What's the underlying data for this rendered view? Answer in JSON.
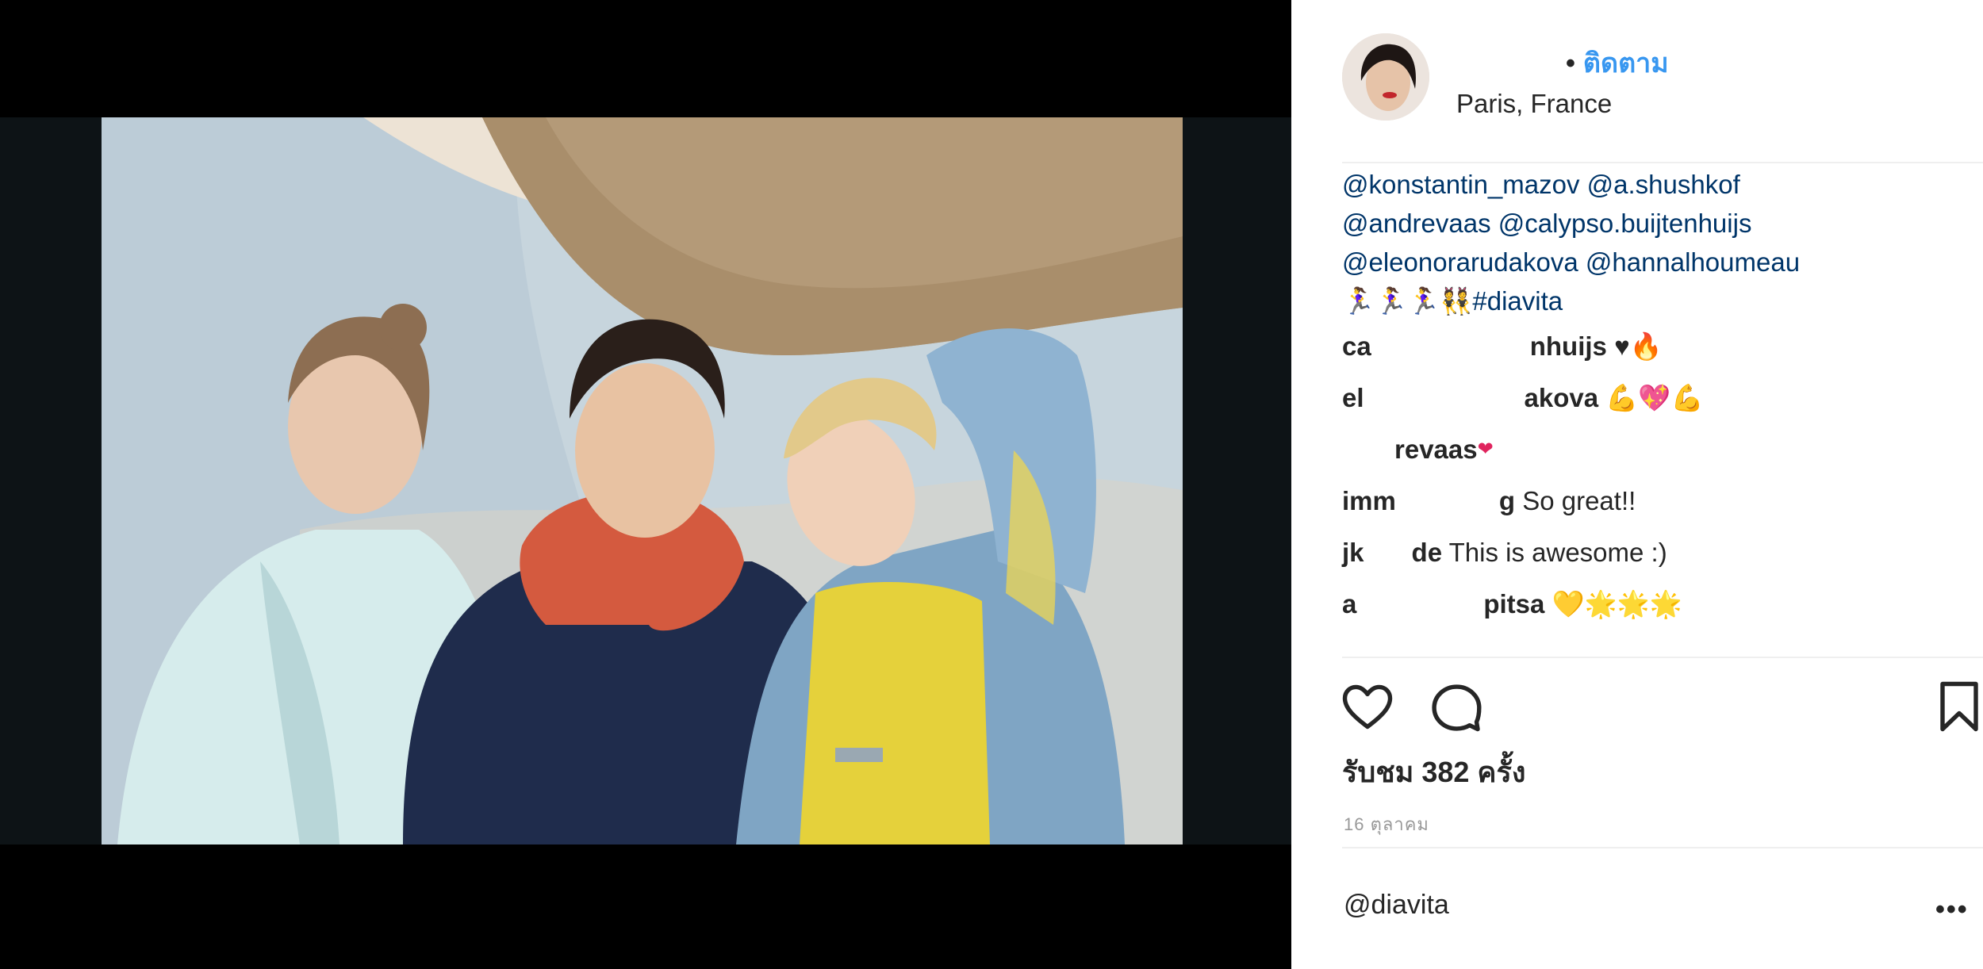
{
  "post": {
    "header": {
      "follow_label": "ติดตาม",
      "location": "Paris, France"
    },
    "caption": {
      "mentions_line1": "@konstantin_mazov @a.shushkof",
      "mentions_line2": "@andrevaas @calypso.buijtenhuijs",
      "mentions_line3": "@eleonorarudakova @hannalhoumeau",
      "emoji_prefix": "🏃‍♀️🏃‍♀️🏃‍♀️👯",
      "hashtag": "#diavita"
    },
    "comments": [
      {
        "user_start": "ca",
        "user_end": "nhuijs",
        "text": "",
        "emoji": "♥🔥"
      },
      {
        "user_start": "el",
        "user_end": "akova",
        "text": "",
        "emoji": "💪💖💪"
      },
      {
        "user_start": "",
        "user_end": "revaas",
        "text": "",
        "emoji": "❤"
      },
      {
        "user_start": "imm",
        "user_end": "g",
        "text": "So great!!",
        "emoji": ""
      },
      {
        "user_start": "jk",
        "user_end": "de",
        "text": "This is awesome :)",
        "emoji": ""
      },
      {
        "user_start": "a",
        "user_end": "pitsa",
        "text": "",
        "emoji": "💛🌟🌟🌟"
      }
    ],
    "icons": {
      "like": "heart-icon",
      "comment": "comment-bubble-icon",
      "save": "bookmark-icon",
      "more": "more-options-icon"
    },
    "views_label": "รับชม 382 ครั้ง",
    "date": "16 ตุลาคม",
    "footer_user": "@diavita",
    "more_label": "•••"
  }
}
